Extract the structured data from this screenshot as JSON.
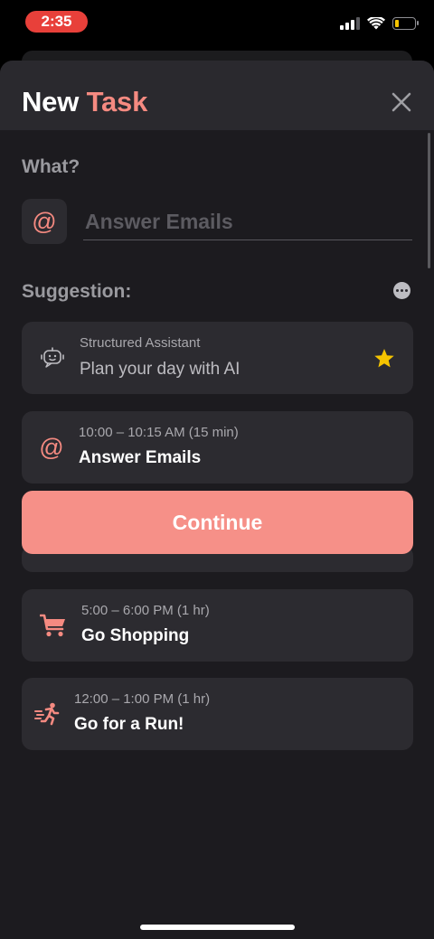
{
  "status_bar": {
    "time": "2:35"
  },
  "header": {
    "title_first": "New",
    "title_accent": "Task"
  },
  "form": {
    "what_label": "What?",
    "task_input": {
      "placeholder": "Answer Emails",
      "value": ""
    },
    "suggestion_label": "Suggestion:"
  },
  "suggestions": [
    {
      "icon": "assistant-robot-icon",
      "subtitle": "Structured Assistant",
      "title": "Plan your day with AI",
      "badge_icon": "star-icon"
    },
    {
      "icon": "at-icon",
      "subtitle": "10:00 – 10:15 AM (15 min)",
      "title": "Answer Emails"
    },
    {
      "icon": "shopping-cart-icon",
      "subtitle": "5:00 – 6:00 PM (1 hr)",
      "title": "Go Shopping"
    },
    {
      "icon": "running-person-icon",
      "subtitle": "12:00 – 1:00 PM (1 hr)",
      "title": "Go for a Run!"
    }
  ],
  "continue_label": "Continue",
  "colors": {
    "accent": "#f58a81",
    "button": "#f69088",
    "background": "#1c1b1f",
    "card": "#2c2b30",
    "star": "#f5c400",
    "status_time_bg": "#e8403a"
  }
}
